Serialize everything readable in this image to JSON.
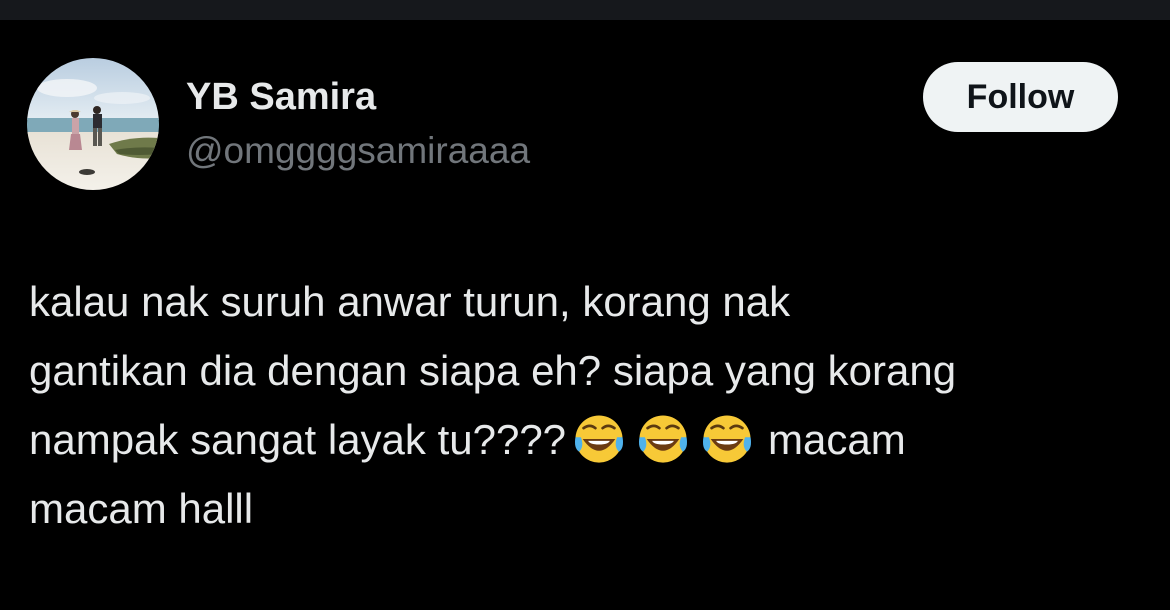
{
  "author": {
    "display_name": "YB Samira",
    "handle": "@omggggsamiraaaa"
  },
  "follow_button": {
    "label": "Follow"
  },
  "tweet": {
    "line1": "kalau nak suruh anwar turun, korang nak",
    "line2": "gantikan dia dengan siapa eh? siapa yang korang",
    "line3_before": "nampak sangat layak tu????",
    "emoji_icons": [
      "face-with-tears-of-joy-icon",
      "face-with-tears-of-joy-icon",
      "face-with-tears-of-joy-icon"
    ],
    "line3_after": "macam",
    "line4": "macam halll"
  },
  "colors": {
    "background": "#000000",
    "text_primary": "#e7e9ea",
    "text_secondary": "#71767b",
    "follow_bg": "#eff3f4"
  }
}
